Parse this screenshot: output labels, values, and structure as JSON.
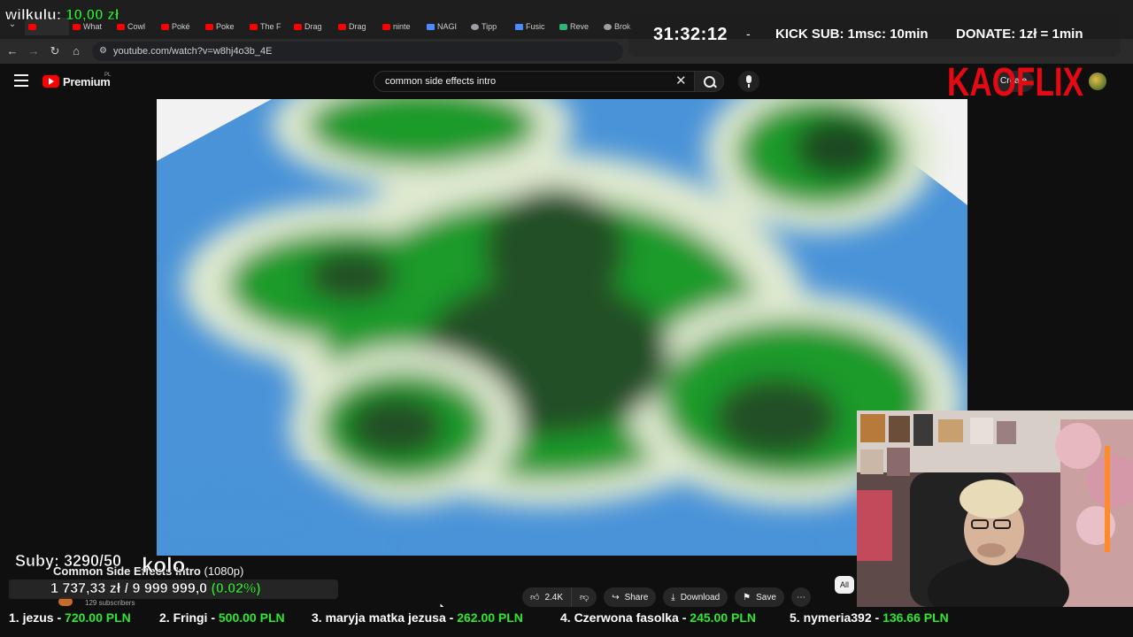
{
  "browser": {
    "tabs": [
      {
        "label": "",
        "icon": "youtube-icon",
        "active": true
      },
      {
        "label": "What",
        "icon": "youtube-icon"
      },
      {
        "label": "Cowl",
        "icon": "youtube-icon"
      },
      {
        "label": "Poké",
        "icon": "youtube-icon"
      },
      {
        "label": "Poke",
        "icon": "youtube-icon"
      },
      {
        "label": "The F",
        "icon": "youtube-icon"
      },
      {
        "label": "Drag",
        "icon": "youtube-icon"
      },
      {
        "label": "Drag",
        "icon": "youtube-icon"
      },
      {
        "label": "ninte",
        "icon": "youtube-icon"
      },
      {
        "label": "NAGI",
        "icon": "doc-icon"
      },
      {
        "label": "Tipp",
        "icon": "generic-icon"
      },
      {
        "label": "Fusic",
        "icon": "doc-icon"
      },
      {
        "label": "Reve",
        "icon": "kick-icon"
      },
      {
        "label": "Brok",
        "icon": "generic-icon"
      }
    ],
    "url": "youtube.com/watch?v=w8hj4o3b_4E"
  },
  "youtube": {
    "brand": "Premium",
    "region": "PL",
    "search_query": "common side effects intro",
    "create_label": "Create",
    "video_title": "Common Side Effects Intro",
    "video_quality": "(1080p)",
    "channel_subscribers": "129 subscribers",
    "likes": "2.4K",
    "share_label": "Share",
    "download_label": "Download",
    "save_label": "Save",
    "chip_label": "All"
  },
  "overlay": {
    "latest_donor": "wilkulu:",
    "latest_donor_amount": "10,00 zł",
    "timer": "31:32:12",
    "separator": "-",
    "kick_sub": "KICK SUB: 1msc: 10min",
    "donate": "DONATE: 1zł = 1min",
    "brand": "KAOFLIX",
    "subs_goal": "Suby: 3290/50",
    "big_word": "kolo",
    "goal_current": "1 737,33 zł",
    "goal_separator": "/",
    "goal_target": "9 999 999,0",
    "goal_percent": "(0.02%)",
    "goal_progress": 0.0002,
    "leaderboard": [
      {
        "text": "1. jezus - ",
        "amount": "720.00 PLN"
      },
      {
        "text": "2. Fringi - ",
        "amount": "500.00 PLN"
      },
      {
        "text": "3. maryja matka jezusa - ",
        "amount": "262.00 PLN"
      },
      {
        "text": "4. Czerwona fasolka - ",
        "amount": "245.00 PLN"
      },
      {
        "text": "5. nymeria392 - ",
        "amount": "136.66 PLN"
      }
    ]
  },
  "colors": {
    "accent_red": "#ff0000",
    "overlay_green": "#2ee82e",
    "brand_red": "#e50914"
  }
}
